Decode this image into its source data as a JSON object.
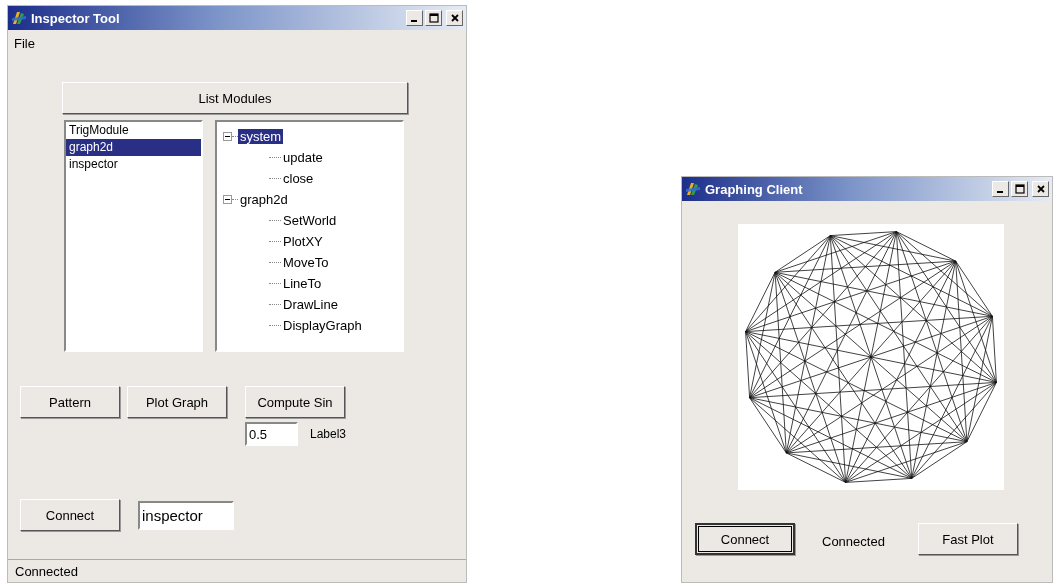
{
  "inspector_window": {
    "title": "Inspector Tool",
    "menu": [
      {
        "label": "File"
      }
    ],
    "list_button": "List Modules",
    "modules": [
      {
        "label": "TrigModule",
        "selected": false
      },
      {
        "label": "graph2d",
        "selected": true
      },
      {
        "label": "inspector",
        "selected": false
      }
    ],
    "tree": [
      {
        "label": "system",
        "selected": true,
        "expanded": true,
        "children": [
          {
            "label": "update",
            "selected": false
          },
          {
            "label": "close",
            "selected": false
          }
        ]
      },
      {
        "label": "graph2d",
        "selected": false,
        "expanded": true,
        "children": [
          {
            "label": "SetWorld",
            "selected": false
          },
          {
            "label": "PlotXY",
            "selected": false
          },
          {
            "label": "MoveTo",
            "selected": false
          },
          {
            "label": "LineTo",
            "selected": false
          },
          {
            "label": "DrawLine",
            "selected": false
          },
          {
            "label": "DisplayGraph",
            "selected": false
          }
        ]
      }
    ],
    "action_buttons": [
      "Pattern",
      "Plot Graph",
      "Compute Sin"
    ],
    "sin_input": {
      "value": "0.5"
    },
    "result_label": "Label3",
    "connect_button": "Connect",
    "name_input": {
      "value": "inspector"
    },
    "status_bar": "Connected"
  },
  "graphing_window": {
    "title": "Graphing Client",
    "buttons": [
      {
        "label": "Connect",
        "default": true
      },
      {
        "label": "Fast Plot",
        "default": false
      }
    ],
    "status_label": "Connected"
  }
}
